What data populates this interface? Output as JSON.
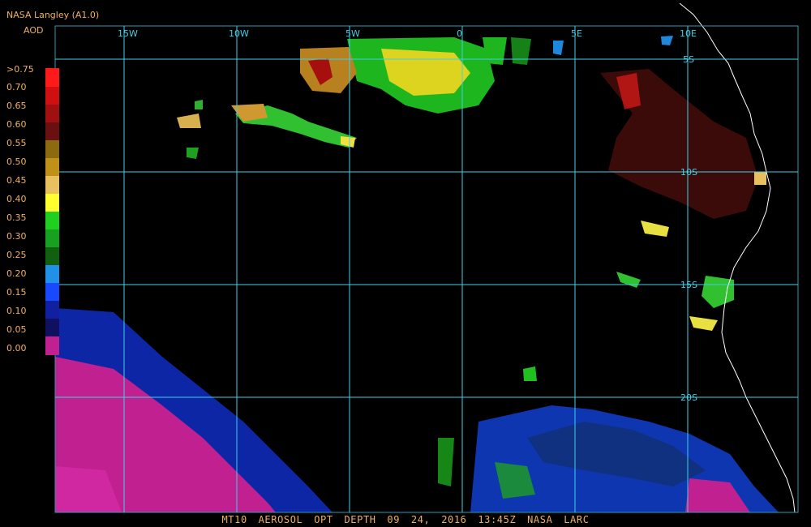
{
  "header": {
    "credit": "NASA Langley (A1.0)",
    "units": "AOD"
  },
  "color_scale": {
    "labels": [
      ">0.75",
      "0.70",
      "0.65",
      "0.60",
      "0.55",
      "0.50",
      "0.45",
      "0.40",
      "0.35",
      "0.30",
      "0.25",
      "0.20",
      "0.15",
      "0.10",
      "0.05",
      "0.00"
    ],
    "colors": [
      "#ff1a1a",
      "#d01010",
      "#a01010",
      "#6b1010",
      "#8b6a10",
      "#c09018",
      "#e8c060",
      "#ffff30",
      "#20d020",
      "#18a020",
      "#106010",
      "#2090e8",
      "#1848ff",
      "#1020a0",
      "#101060",
      "#c02090"
    ]
  },
  "map": {
    "background": "#000000",
    "grid_color": "#3fd0e8",
    "coast_color": "#ffffff",
    "lon_labels": [
      "15W",
      "10W",
      "5W",
      "0",
      "5E",
      "10E"
    ],
    "lat_labels": [
      "5S",
      "10S",
      "15S",
      "20S"
    ]
  },
  "footer": {
    "text": "MT10  AEROSOL OPT DEPTH  09 24, 2016 13:45Z  NASA LARC"
  }
}
